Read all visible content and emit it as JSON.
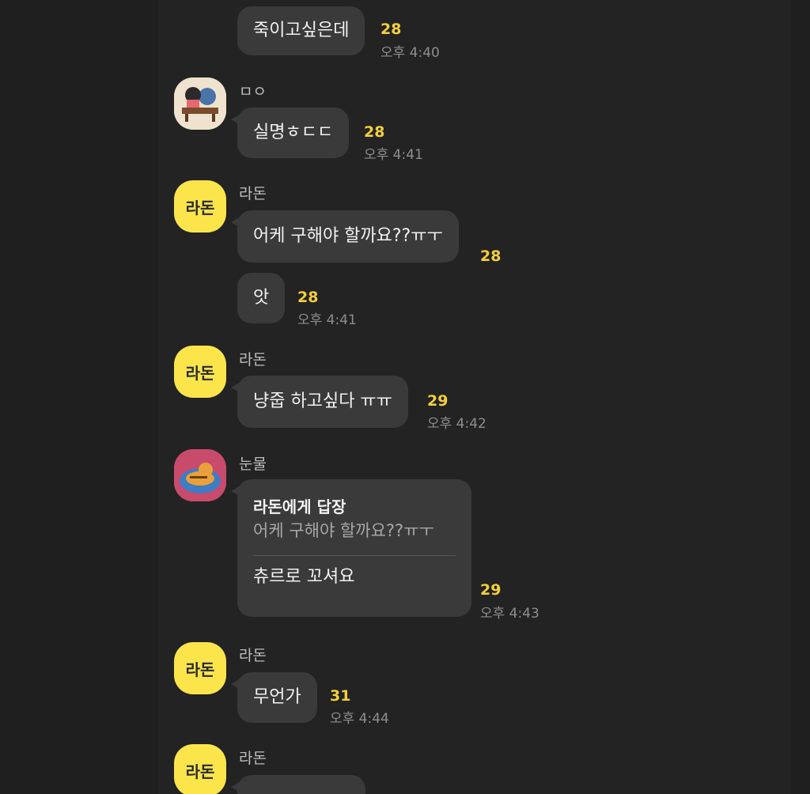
{
  "messages": [
    {
      "text": "죽이고싶은데",
      "count": "28",
      "time": "오후 4:40"
    },
    {
      "sender": "ㅁㅇ",
      "text": "실명ㅎㄷㄷ",
      "count": "28",
      "time": "오후 4:41"
    },
    {
      "sender": "라돈",
      "avatar_text": "라돈",
      "text": "어케 구해야 할까요??ㅠㅜ",
      "count": "28"
    },
    {
      "text": "앗",
      "count": "28",
      "time": "오후 4:41"
    },
    {
      "sender": "라돈",
      "avatar_text": "라돈",
      "text": "냥줍 하고싶다 ㅠㅠ",
      "count": "29",
      "time": "오후 4:42"
    },
    {
      "sender": "눈물",
      "reply_title": "라돈에게 답장",
      "reply_quote": "어케 구해야 할까요??ㅠㅜ",
      "text": "츄르로 꼬셔요",
      "count": "29",
      "time": "오후 4:43"
    },
    {
      "sender": "라돈",
      "avatar_text": "라돈",
      "text": "무언가",
      "count": "31",
      "time": "오후 4:44"
    },
    {
      "sender": "라돈",
      "avatar_text": "라돈"
    }
  ],
  "colors": {
    "background": "#1f1f1f",
    "bubble": "#3a3a3a",
    "unread_count": "#f3cf3c",
    "avatar_yellow": "#fbe54b"
  }
}
